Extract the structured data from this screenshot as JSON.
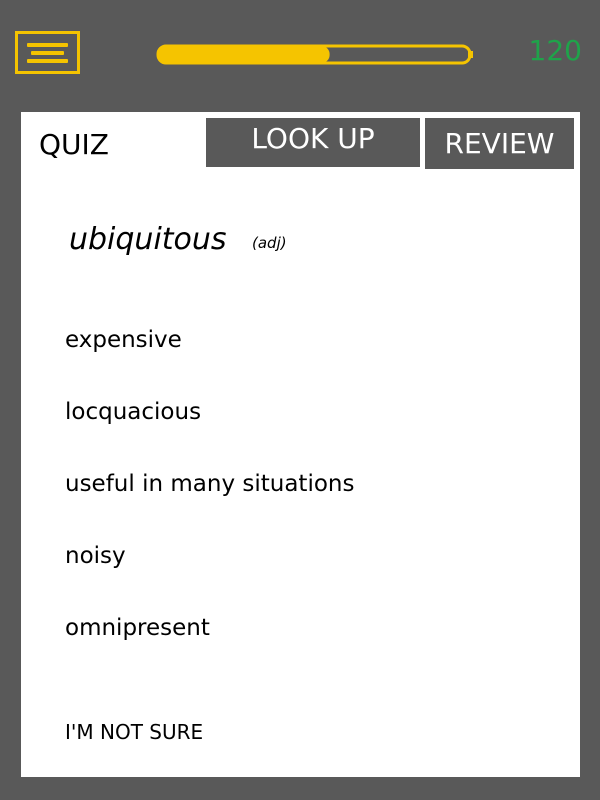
{
  "header": {
    "menu_icon": "hamburger-menu-icon",
    "progress": 0.55,
    "score": "120"
  },
  "tabs": {
    "quiz": "QUIZ",
    "lookup": "LOOK UP",
    "review": "REVIEW"
  },
  "question": {
    "word": "ubiquitous",
    "part_of_speech": "(adj)"
  },
  "options": [
    "expensive",
    "locquacious",
    "useful in many situations",
    "noisy",
    "omnipresent"
  ],
  "not_sure": "I'M NOT SURE",
  "colors": {
    "background": "#595959",
    "accent": "#f5c400",
    "score": "#1fa34a",
    "card": "#ffffff"
  }
}
